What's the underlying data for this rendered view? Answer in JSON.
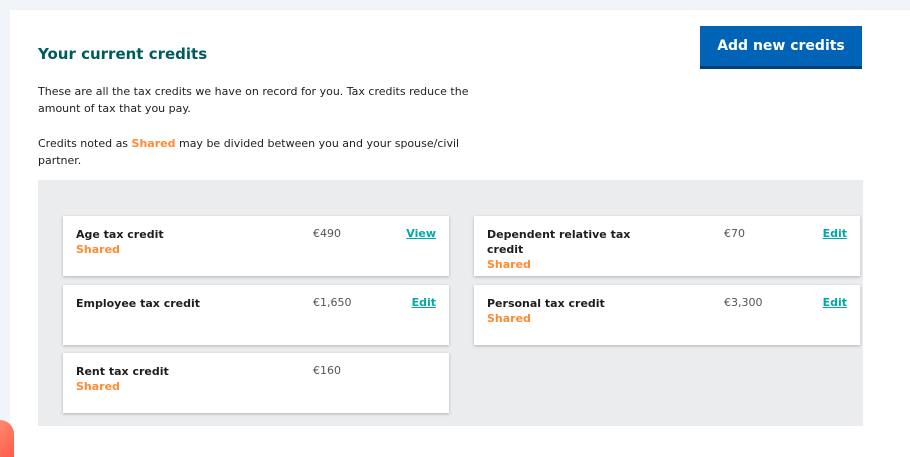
{
  "page": {
    "title": "Your current credits",
    "intro": "These are all the tax credits we have on record for you. Tax credits reduce the amount of tax that you pay.",
    "note_prefix": "Credits noted as ",
    "note_shared": "Shared",
    "note_suffix": " may be divided between you and your spouse/civil partner.",
    "add_button": "Add new credits"
  },
  "credits": [
    {
      "name": "Age tax credit",
      "status": "Shared",
      "amount": "€490",
      "action": "View"
    },
    {
      "name": "Dependent relative tax credit",
      "status": "Shared",
      "amount": "€70",
      "action": "Edit"
    },
    {
      "name": "Employee tax credit",
      "status": "",
      "amount": "€1,650",
      "action": "Edit"
    },
    {
      "name": "Personal tax credit",
      "status": "Shared",
      "amount": "€3,300",
      "action": "Edit"
    },
    {
      "name": "Rent tax credit",
      "status": "Shared",
      "amount": "€160",
      "action": ""
    }
  ],
  "colors": {
    "title": "#005b5d",
    "button": "#0063b6",
    "shared": "#ff8a30",
    "link": "#00a8a8",
    "panel": "#ebecee"
  }
}
